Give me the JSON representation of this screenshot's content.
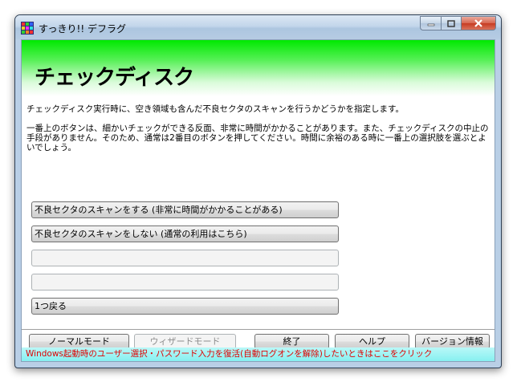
{
  "window": {
    "title": "すっきり!! デフラグ",
    "icon": "app-icon"
  },
  "banner": {
    "title": "チェックディスク"
  },
  "description": {
    "line1": "チェックディスク実行時に、空き領域も含んだ不良セクタのスキャンを行うかどうかを指定します。",
    "line2": "一番上のボタンは、細かいチェックができる反面、非常に時間がかかることがあります。また、チェックディスクの中止の手段がありません。そのため、通常は2番目のボタンを押してください。時間に余裕のある時に一番上の選択肢を選ぶとよいでしょう。"
  },
  "choices": [
    {
      "label": "不良セクタのスキャンをする (非常に時間がかかることがある)",
      "enabled": true
    },
    {
      "label": "不良セクタのスキャンをしない (通常の利用はこちら)",
      "enabled": true
    },
    {
      "label": "",
      "enabled": false
    },
    {
      "label": "",
      "enabled": false
    },
    {
      "label": "1つ戻る",
      "enabled": true
    }
  ],
  "bottom_bar": {
    "normal_mode": "ノーマルモード",
    "wizard_mode": "ウィザードモード",
    "exit": "終了",
    "help": "ヘルプ",
    "version_info": "バージョン情報"
  },
  "status_link": "Windows起動時のユーザー選択・パスワード入力を復活(自動ログオンを解除)したいときはここをクリック",
  "colors": {
    "banner_green": "#00e900",
    "link_red": "#e00000",
    "status_bg": "#86f0f0"
  }
}
